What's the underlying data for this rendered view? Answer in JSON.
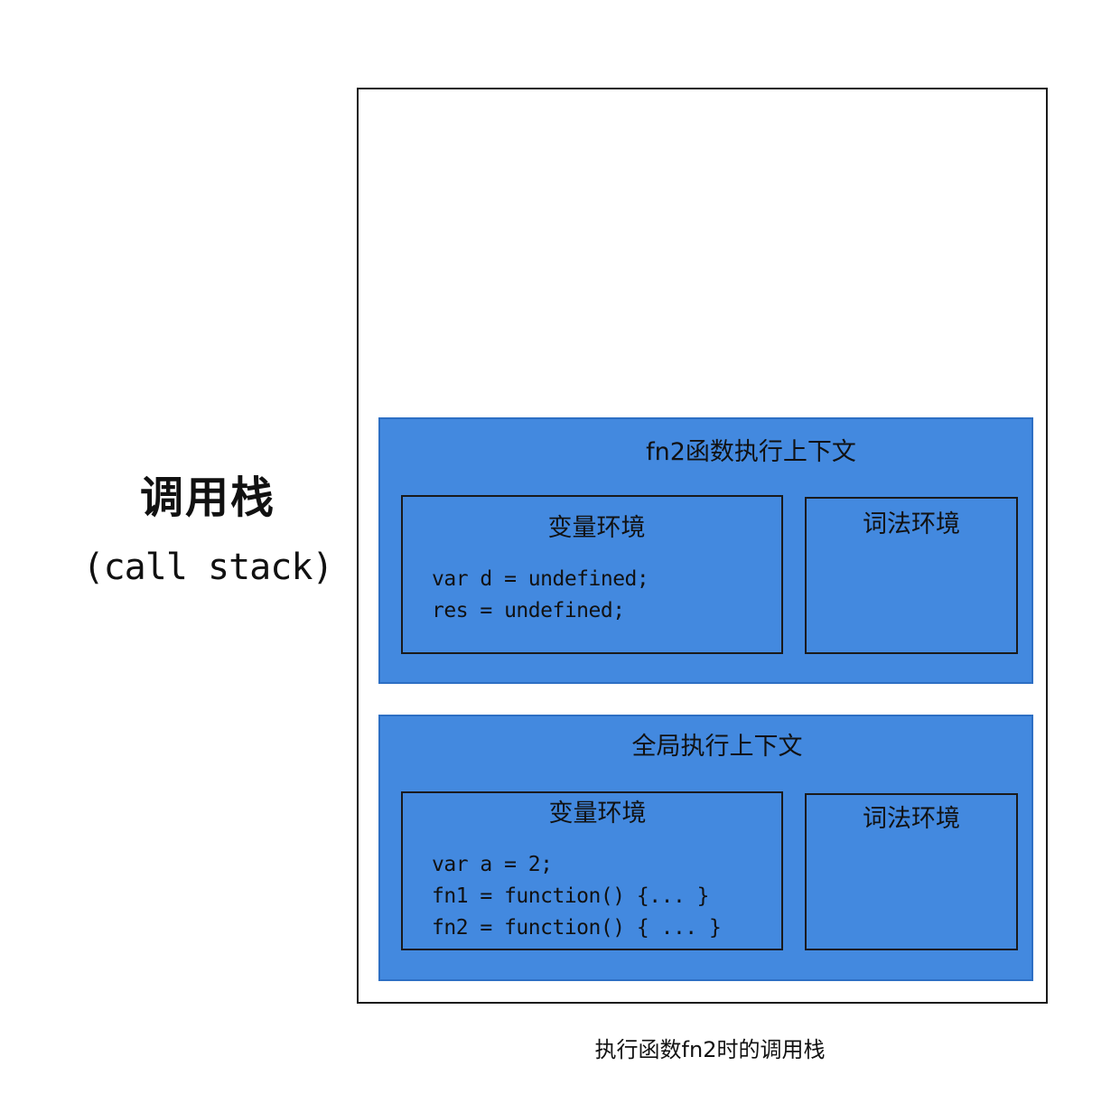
{
  "call_stack_label": {
    "zh": "调用栈",
    "en": "(call stack)"
  },
  "frames": {
    "fn2": {
      "title": "fn2函数执行上下文",
      "variable_env": {
        "title": "变量环境",
        "lines": [
          "var d = undefined;",
          "res = undefined;"
        ]
      },
      "lexical_env": {
        "title": "词法环境"
      }
    },
    "global": {
      "title": "全局执行上下文",
      "variable_env": {
        "title": "变量环境",
        "lines": [
          "var a = 2;",
          "fn1 = function() {... }",
          "fn2 = function() { ... }"
        ]
      },
      "lexical_env": {
        "title": "词法环境"
      }
    }
  },
  "caption": "执行函数fn2时的调用栈",
  "colors": {
    "frame_fill": "#4389df",
    "outline": "#1a1a1a"
  }
}
